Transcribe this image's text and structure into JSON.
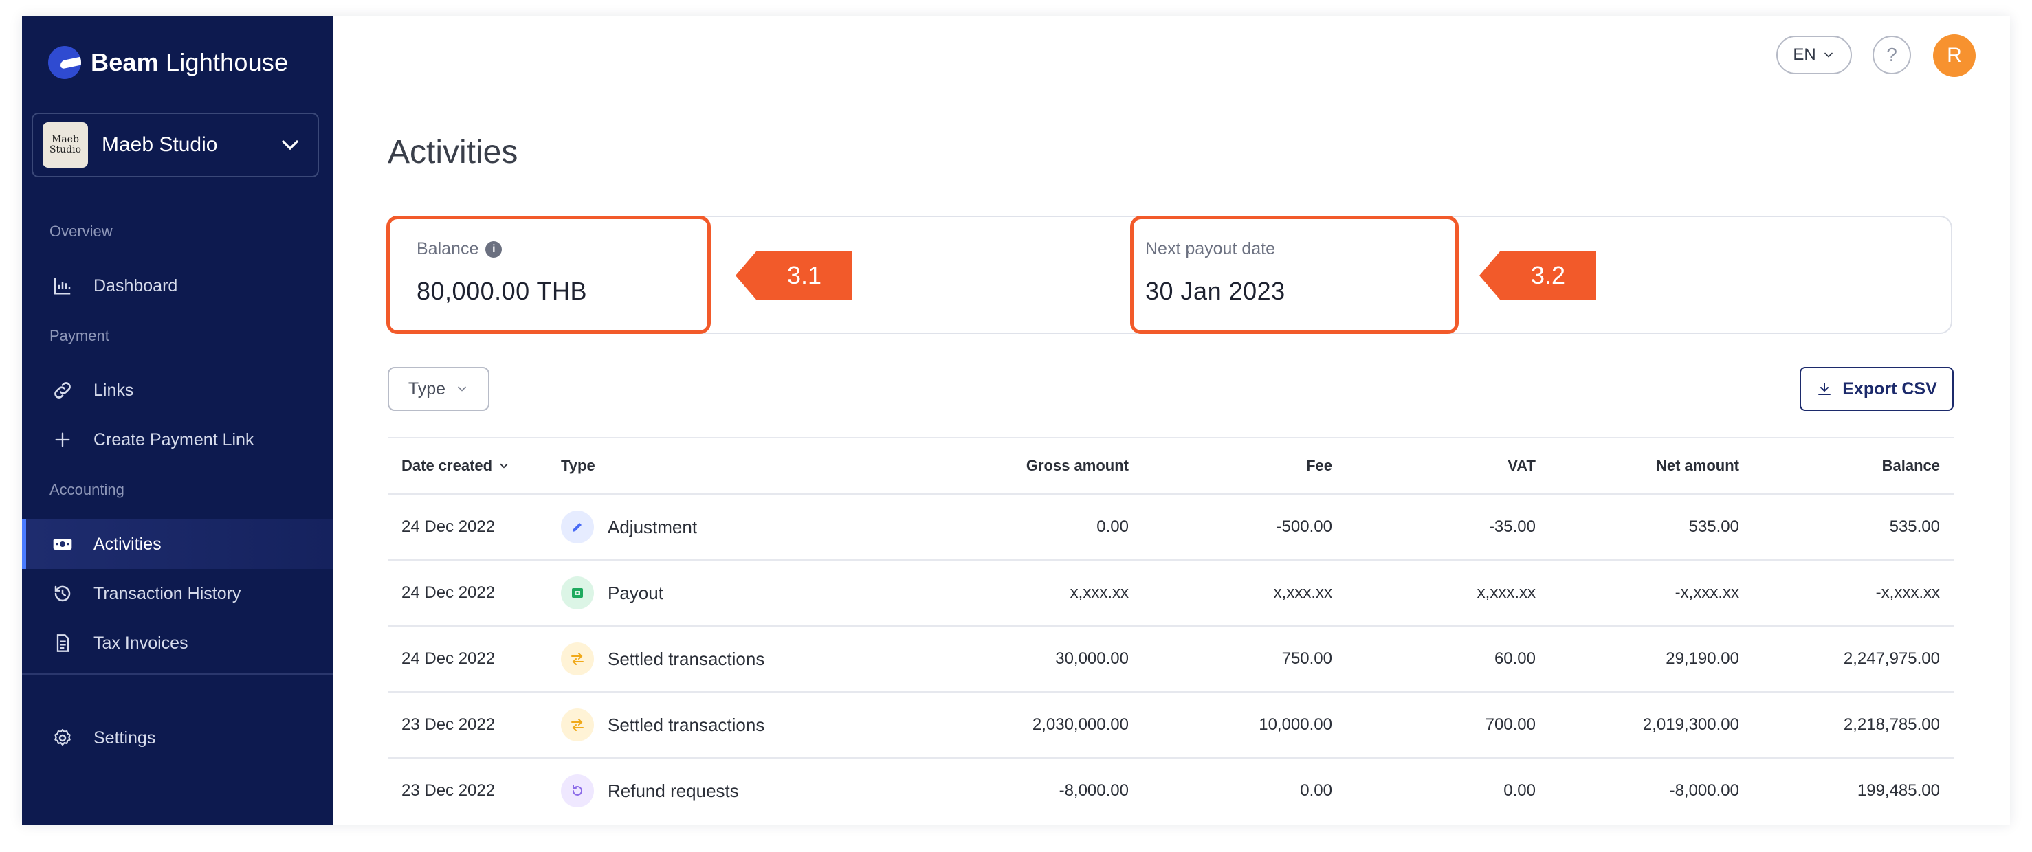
{
  "brand": {
    "name_bold": "Beam",
    "name_rest": " Lighthouse"
  },
  "workspace": {
    "avatar_text": "Maeb Studio",
    "name": "Maeb Studio"
  },
  "sidebar": {
    "sections": [
      {
        "label": "Overview"
      },
      {
        "label": "Payment"
      },
      {
        "label": "Accounting"
      }
    ],
    "items": [
      {
        "label": "Dashboard",
        "icon": "bar-chart-icon"
      },
      {
        "label": "Links",
        "icon": "link-icon"
      },
      {
        "label": "Create Payment Link",
        "icon": "plus-icon"
      },
      {
        "label": "Activities",
        "icon": "banknote-icon",
        "active": true
      },
      {
        "label": "Transaction History",
        "icon": "history-icon"
      },
      {
        "label": "Tax Invoices",
        "icon": "document-icon"
      },
      {
        "label": "Settings",
        "icon": "gear-icon"
      }
    ]
  },
  "header": {
    "language": "EN",
    "help": "?",
    "user_initial": "R"
  },
  "page": {
    "title": "Activities"
  },
  "summary": {
    "balance": {
      "label": "Balance",
      "value": "80,000.00 THB"
    },
    "payout": {
      "label": "Next payout date",
      "value": "30 Jan 2023"
    }
  },
  "callouts": [
    "3.1",
    "3.2"
  ],
  "filters": {
    "type_label": "Type",
    "export_label": "Export CSV"
  },
  "table": {
    "columns": [
      "Date created",
      "Type",
      "Gross amount",
      "Fee",
      "VAT",
      "Net amount",
      "Balance"
    ],
    "rows": [
      {
        "date": "24 Dec 2022",
        "type": "Adjustment",
        "icon": "pencil-icon",
        "gross": "0.00",
        "fee": "-500.00",
        "vat": "-35.00",
        "net": "535.00",
        "balance": "535.00"
      },
      {
        "date": "24 Dec 2022",
        "type": "Payout",
        "icon": "cash-icon",
        "gross": "x,xxx.xx",
        "fee": "x,xxx.xx",
        "vat": "x,xxx.xx",
        "net": "-x,xxx.xx",
        "balance": "-x,xxx.xx"
      },
      {
        "date": "24 Dec 2022",
        "type": "Settled transactions",
        "icon": "transfer-arrows-icon",
        "gross": "30,000.00",
        "fee": "750.00",
        "vat": "60.00",
        "net": "29,190.00",
        "balance": "2,247,975.00"
      },
      {
        "date": "23 Dec 2022",
        "type": "Settled transactions",
        "icon": "transfer-arrows-icon",
        "gross": "2,030,000.00",
        "fee": "10,000.00",
        "vat": "700.00",
        "net": "2,019,300.00",
        "balance": "2,218,785.00"
      },
      {
        "date": "23 Dec 2022",
        "type": "Refund requests",
        "icon": "refund-icon",
        "gross": "-8,000.00",
        "fee": "0.00",
        "vat": "0.00",
        "net": "-8,000.00",
        "balance": "199,485.00"
      }
    ]
  },
  "colors": {
    "sidebar_bg": "#0d1a4f",
    "accent_orange": "#f25a2a",
    "avatar_orange": "#f7922f",
    "primary_navy": "#1c2a6b"
  }
}
